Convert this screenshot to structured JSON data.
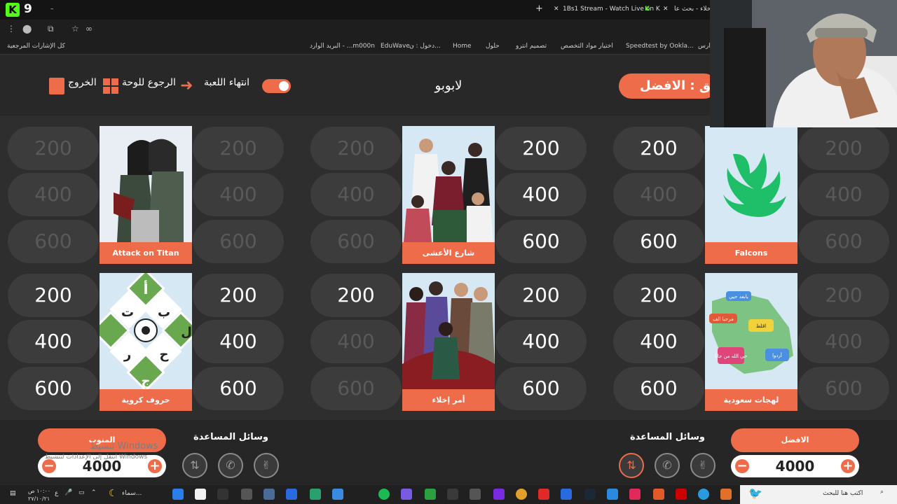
{
  "browser": {
    "tabs": [
      "1Bs1 Stream - Watch Live on K",
      "خلاء - بحث عا"
    ],
    "bookmarks": [
      "دارس",
      "Speedtest by Ookla...",
      "اختيار مواد التخصص",
      "تصميم انترو",
      "حلول",
      "Home",
      "دخول : ن...",
      "EduWave -",
      "البريد الوارد - ...m000n",
      "كل الإشارات المرجعية"
    ],
    "logo_number": "9"
  },
  "header": {
    "exit_label": "الخروج",
    "back_label": "الرجوع للوحة",
    "end_label": "انتهاء اللعبة",
    "game_name": "لابوبو",
    "turn_text": "فريق : الافضل"
  },
  "board": {
    "columns": [
      {
        "top": {
          "name": "Attack on Titan",
          "left": [
            "200",
            "400",
            "600"
          ],
          "right": [
            "200",
            "400",
            "600"
          ]
        },
        "bottom": {
          "name": "حروف كروية",
          "left": [
            "200",
            "400",
            "600"
          ],
          "right": [
            "200",
            "400",
            "600"
          ]
        }
      },
      {
        "top": {
          "name": "شارع الأعشى",
          "left": [
            "200",
            "400",
            "600"
          ],
          "right": [
            "200",
            "400",
            "600"
          ]
        },
        "bottom": {
          "name": "أمر إخلاء",
          "left": [
            "200",
            "400",
            "600"
          ],
          "right": [
            "200",
            "400",
            "600"
          ]
        }
      },
      {
        "top": {
          "name": "Falcons",
          "left": [
            "200",
            "400",
            "600"
          ],
          "right": [
            "200",
            "400",
            "600"
          ]
        },
        "bottom": {
          "name": "لهجات سعودية",
          "left": [
            "200",
            "400",
            "600"
          ],
          "right": [
            "200",
            "400",
            "600"
          ]
        }
      }
    ],
    "card_art_text": {
      "letters": [
        "أ",
        "ب",
        "ت",
        "ل",
        "ح",
        "ر",
        "ج"
      ],
      "dialects": [
        "يابعد حيي",
        "مرحبا الف",
        "اقلط",
        "حي الله من جانا",
        "أردوا"
      ]
    }
  },
  "teams": {
    "left": {
      "name": "المنوب",
      "score": "4000",
      "aids_label": "وسائل المساعدة"
    },
    "right": {
      "name": "الافضل",
      "score": "4000",
      "aids_label": "وسائل المساعدة"
    }
  },
  "watermark": {
    "line1": "تنشيط Windows",
    "line2": "انتقل إلى الإعدادات لتنشيط Windows"
  },
  "taskbar": {
    "search_placeholder": "اكتب هنا للبحث",
    "weather": "سماء...",
    "time": "١٠:٠٠ ص",
    "date": "٢٧/١٠/٢١",
    "lang": "ع"
  },
  "colors": {
    "accent": "#ef6c4a",
    "bg": "#2e2e2e",
    "pill": "#3c3c3c",
    "used_text": "#595959"
  }
}
